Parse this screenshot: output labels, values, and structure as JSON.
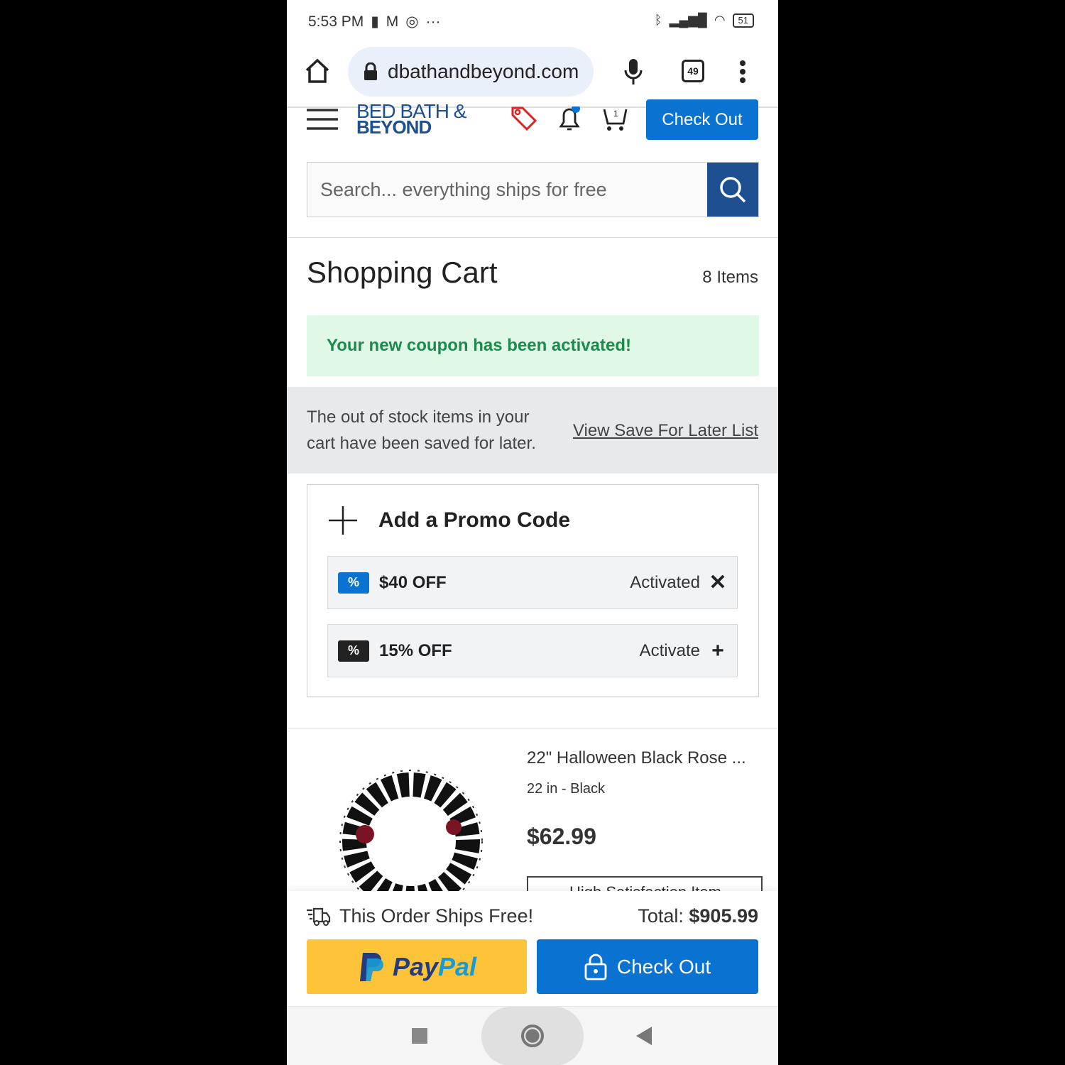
{
  "status_bar": {
    "time": "5:53 PM",
    "more": "···",
    "battery": "51"
  },
  "browser": {
    "url": "dbathandbeyond.com",
    "tab_count": "49"
  },
  "header": {
    "logo_line1": "BED BATH &",
    "logo_line2": "BEYOND",
    "checkout_label": "Check Out",
    "cart_count": "1"
  },
  "search": {
    "placeholder": "Search... everything ships for free"
  },
  "cart": {
    "title": "Shopping Cart",
    "item_count": "8 Items"
  },
  "alert": {
    "message": "Your new coupon has been activated!"
  },
  "out_of_stock": {
    "message": "The out of stock items in your cart have been saved for later.",
    "link": "View Save For Later List"
  },
  "promo": {
    "heading": "Add a Promo Code",
    "coupons": [
      {
        "name": "$40 OFF",
        "status": "Activated",
        "action": "✕",
        "color": "#0a72d1"
      },
      {
        "name": "15% OFF",
        "status": "Activate",
        "action": "+",
        "color": "#222222"
      }
    ]
  },
  "product": {
    "name": "22\" Halloween Black Rose ...",
    "variant": "22 in - Black",
    "price": "$62.99",
    "badge": "High Satisfaction Item"
  },
  "footer": {
    "shipping": "This Order Ships Free!",
    "total_label": "Total:",
    "total_value": "$905.99",
    "paypal_pay": "Pay",
    "paypal_pal": "Pal",
    "checkout_label": "Check Out"
  },
  "colors": {
    "brand_blue": "#1d4f91",
    "button_blue": "#0a72d1",
    "paypal_yellow": "#fdc439",
    "success_green": "#1c8a4a"
  }
}
